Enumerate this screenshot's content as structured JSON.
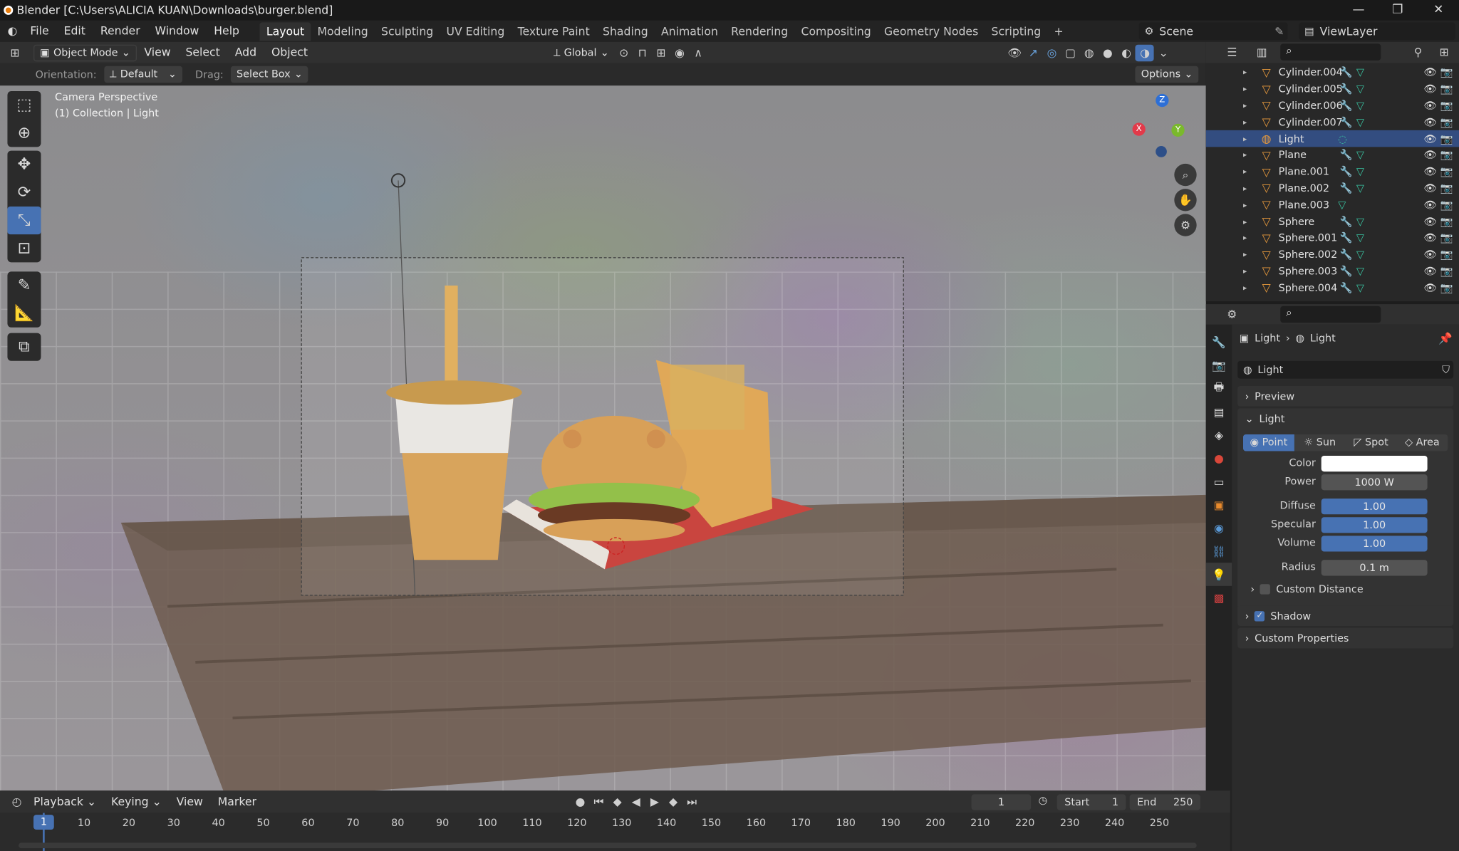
{
  "window": {
    "title": "Blender [C:\\Users\\ALICIA KUAN\\Downloads\\burger.blend]"
  },
  "menu": [
    "File",
    "Edit",
    "Render",
    "Window",
    "Help"
  ],
  "workspaces": [
    "Layout",
    "Modeling",
    "Sculpting",
    "UV Editing",
    "Texture Paint",
    "Shading",
    "Animation",
    "Rendering",
    "Compositing",
    "Geometry Nodes",
    "Scripting"
  ],
  "scene": {
    "name": "Scene",
    "view_layer": "ViewLayer"
  },
  "header": {
    "mode": "Object Mode",
    "view": "View",
    "select": "Select",
    "add": "Add",
    "object": "Object",
    "transform": "Global"
  },
  "header2": {
    "orientation_label": "Orientation:",
    "orientation": "Default",
    "drag_label": "Drag:",
    "drag": "Select Box",
    "options": "Options"
  },
  "viewport": {
    "perspective": "Camera Perspective",
    "collection": "(1) Collection | Light",
    "axis_x": "X",
    "axis_y": "Y",
    "axis_z": "Z"
  },
  "outliner": {
    "items": [
      {
        "name": "Cylinder.004",
        "mods": true,
        "mesh": true,
        "selected": false
      },
      {
        "name": "Cylinder.005",
        "mods": true,
        "mesh": true,
        "selected": false
      },
      {
        "name": "Cylinder.006",
        "mods": true,
        "mesh": true,
        "selected": false
      },
      {
        "name": "Cylinder.007",
        "mods": true,
        "mesh": true,
        "selected": false
      },
      {
        "name": "Light",
        "mods": false,
        "mesh": false,
        "selected": true
      },
      {
        "name": "Plane",
        "mods": true,
        "mesh": true,
        "selected": false
      },
      {
        "name": "Plane.001",
        "mods": true,
        "mesh": true,
        "selected": false
      },
      {
        "name": "Plane.002",
        "mods": true,
        "mesh": true,
        "selected": false
      },
      {
        "name": "Plane.003",
        "mods": false,
        "mesh": true,
        "selected": false
      },
      {
        "name": "Sphere",
        "mods": true,
        "mesh": true,
        "selected": false
      },
      {
        "name": "Sphere.001",
        "mods": true,
        "mesh": true,
        "selected": false
      },
      {
        "name": "Sphere.002",
        "mods": true,
        "mesh": true,
        "selected": false
      },
      {
        "name": "Sphere.003",
        "mods": true,
        "mesh": true,
        "selected": false
      },
      {
        "name": "Sphere.004",
        "mods": true,
        "mesh": true,
        "selected": false
      }
    ]
  },
  "properties": {
    "breadcrumb_obj": "Light",
    "breadcrumb_data": "Light",
    "datablock": "Light",
    "preview": "Preview",
    "light_panel": "Light",
    "types": [
      "Point",
      "Sun",
      "Spot",
      "Area"
    ],
    "color_label": "Color",
    "power_label": "Power",
    "power": "1000 W",
    "diffuse_label": "Diffuse",
    "diffuse": "1.00",
    "specular_label": "Specular",
    "specular": "1.00",
    "volume_label": "Volume",
    "volume": "1.00",
    "radius_label": "Radius",
    "radius": "0.1 m",
    "custom_distance": "Custom Distance",
    "shadow": "Shadow",
    "custom_properties": "Custom Properties"
  },
  "timeline": {
    "playback": "Playback",
    "keying": "Keying",
    "view": "View",
    "marker": "Marker",
    "current": "1",
    "start_label": "Start",
    "start": "1",
    "end_label": "End",
    "end": "250",
    "ticks": [
      "1",
      "10",
      "20",
      "30",
      "40",
      "50",
      "60",
      "70",
      "80",
      "90",
      "100",
      "110",
      "120",
      "130",
      "140",
      "150",
      "160",
      "170",
      "180",
      "190",
      "200",
      "210",
      "220",
      "230",
      "240",
      "250"
    ]
  }
}
